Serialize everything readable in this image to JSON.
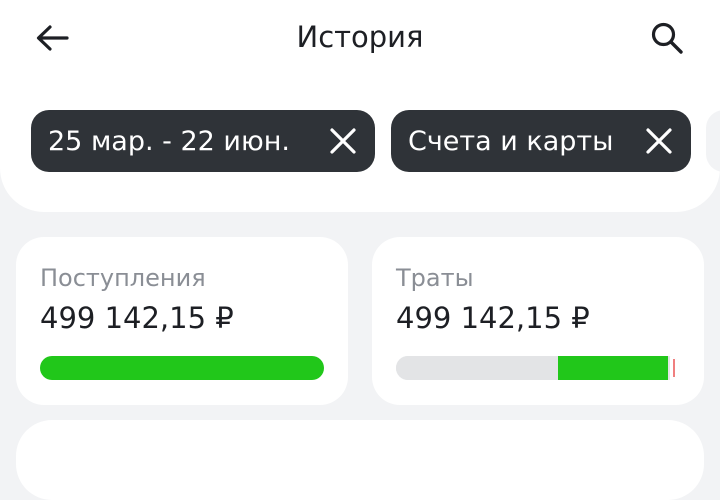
{
  "header": {
    "title": "История",
    "back_icon": "arrow-left-icon",
    "search_icon": "search-icon"
  },
  "filters": {
    "chips": [
      {
        "label": "25 мар. - 22 июн.",
        "icon": "close-icon"
      },
      {
        "label": "Счета и карты",
        "icon": "close-icon"
      }
    ]
  },
  "summary": {
    "income": {
      "title": "Поступления",
      "amount": "499 142,15 ₽",
      "bar_fill": 1.0,
      "color": "#21c71a"
    },
    "expenses": {
      "title": "Траты",
      "amount": "499 142,15 ₽",
      "segments": [
        {
          "share": 0.56,
          "color": "#e3e4e6"
        },
        {
          "share": 0.4,
          "color": "#21c71a"
        },
        {
          "share": 0.04,
          "color": "#f07f7f"
        }
      ]
    }
  },
  "colors": {
    "chip_bg": "#2f3338",
    "accent_green": "#21c71a",
    "background": "#f2f3f5"
  }
}
